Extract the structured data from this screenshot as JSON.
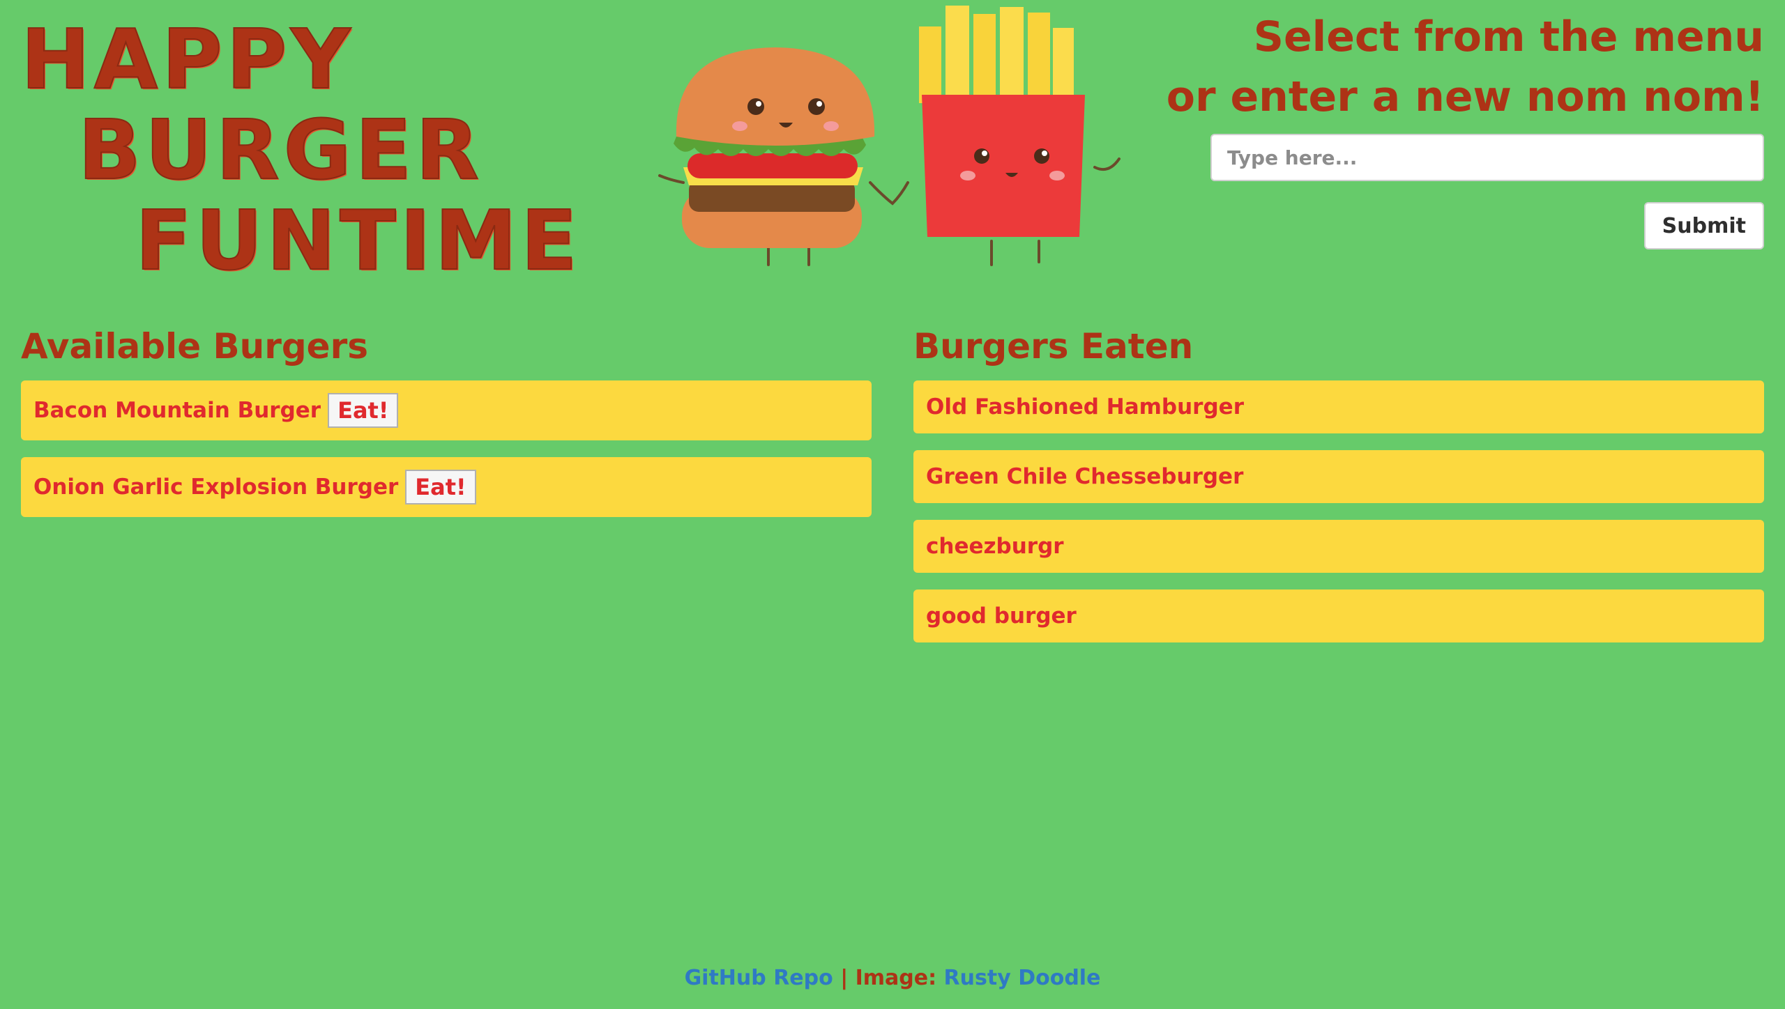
{
  "header": {
    "title_lines": [
      "HAPPY",
      "BURGER",
      "FUNTIME"
    ]
  },
  "form": {
    "tagline_line1": "Select from the menu",
    "tagline_line2": "or enter a new nom nom!",
    "input_placeholder": "Type here...",
    "input_value": "",
    "submit_label": "Submit"
  },
  "available": {
    "heading": "Available Burgers",
    "eat_label": "Eat!",
    "items": [
      {
        "name": "Bacon Mountain Burger"
      },
      {
        "name": "Onion Garlic Explosion Burger"
      }
    ]
  },
  "eaten": {
    "heading": "Burgers Eaten",
    "items": [
      {
        "name": "Old Fashioned Hamburger"
      },
      {
        "name": "Green Chile Chesseburger"
      },
      {
        "name": "cheezburgr"
      },
      {
        "name": "good burger"
      }
    ]
  },
  "footer": {
    "repo_link": "GitHub Repo",
    "separator": "|",
    "image_label": "Image:",
    "image_link": "Rusty Doodle"
  },
  "colors": {
    "background": "#66cb6a",
    "heading_text": "#ad3316",
    "card": "#fcd93f",
    "card_text": "#e0292e",
    "link": "#2f7ac4"
  },
  "illustration": {
    "icons": [
      "burger-mascot-icon",
      "fries-mascot-icon"
    ]
  }
}
